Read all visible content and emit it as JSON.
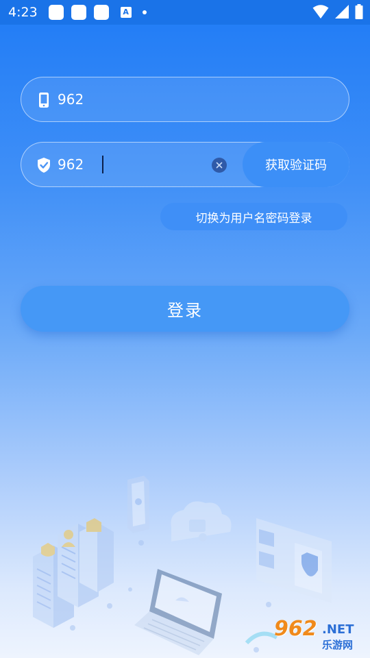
{
  "status_bar": {
    "time": "4:23",
    "notification_letter": "A"
  },
  "phone_field": {
    "value": "962",
    "icon": "phone-icon"
  },
  "code_field": {
    "value": "962",
    "icon": "shield-check-icon",
    "get_code_label": "获取验证码"
  },
  "switch_login_label": "切换为用户名密码登录",
  "login_label": "登录",
  "watermark": {
    "logo": "962",
    "net": ".NET",
    "subtitle": "乐游网"
  },
  "colors": {
    "status_bar": "#1a73e8",
    "button": "#3f8ff7",
    "clear_icon": "#2f5aa8"
  }
}
